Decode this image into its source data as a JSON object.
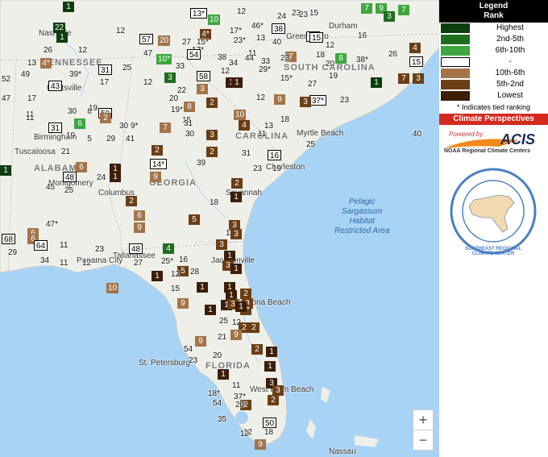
{
  "legend": {
    "title": "Legend",
    "subtitle": "Rank",
    "items": [
      {
        "label": "Highest",
        "color": "#0d3d0d"
      },
      {
        "label": "2nd-5th",
        "color": "#1f6d1f"
      },
      {
        "label": "6th-10th",
        "color": "#3fa63f"
      },
      {
        "label": "-",
        "color": "#ffffff"
      },
      {
        "label": "10th-6th",
        "color": "#a3744a"
      },
      {
        "label": "5th-2nd",
        "color": "#6b3e16"
      },
      {
        "label": "Lowest",
        "color": "#3c1e08"
      }
    ],
    "note": "* Indicates tied ranking"
  },
  "climate_perspectives": "Climate Perspectives",
  "acis": {
    "powered_by": "Powered by",
    "name": "ACIS",
    "sub": "NOAA Regional Climate Centers"
  },
  "logo": {
    "text": "SOUTHEAST REGIONAL CLIMATE CENTER"
  },
  "zoom": {
    "in": "+",
    "out": "−"
  },
  "colors": {
    "water": "#a9d3f5",
    "land": "#efefe9",
    "g1": "#0d3d0d",
    "g2": "#1f6d1f",
    "g3": "#3fa63f",
    "b1": "#a3744a",
    "b2": "#6b3e16",
    "b3": "#3c1e08"
  },
  "labels": {
    "states": [
      "TENNESSEE",
      "SOUTH CAROLINA",
      "CAROLINA",
      "ALABAMA",
      "GEORGIA",
      "FLORIDA"
    ],
    "cities": [
      "Nashville",
      "Huntsville",
      "Birmingham",
      "Tuscaloosa",
      "Montgomery",
      "Columbus",
      "Savannah",
      "Charleston",
      "Myrtle Beach",
      "Durham",
      "Greensboro",
      "Tallahassee",
      "Panama City",
      "Jacksonville",
      "Daytona Beach",
      "St. Petersburg",
      "West Palm Beach",
      "Nassau"
    ],
    "features": [
      "Pelagic\nSargassum\nHabitat\nRestricted Area"
    ]
  },
  "markers": [
    {
      "t": "1",
      "s": "g1"
    },
    {
      "t": "22",
      "s": "g1"
    },
    {
      "t": "1",
      "s": "g1"
    },
    {
      "t": "13*",
      "s": "box"
    },
    {
      "t": "10",
      "s": "g3"
    },
    {
      "t": "12",
      "s": "plain"
    },
    {
      "t": "7",
      "s": "g3"
    },
    {
      "t": "9",
      "s": "g3"
    },
    {
      "t": "3",
      "s": "g2"
    },
    {
      "t": "7",
      "s": "g3"
    },
    {
      "t": "24",
      "s": "plain"
    },
    {
      "t": "23",
      "s": "plain"
    },
    {
      "t": "15",
      "s": "plain"
    },
    {
      "t": "12",
      "s": "plain"
    },
    {
      "t": "57",
      "s": "box"
    },
    {
      "t": "20",
      "s": "b1"
    },
    {
      "t": "17*",
      "s": "plain"
    },
    {
      "t": "4*",
      "s": "b2"
    },
    {
      "t": "46*",
      "s": "plain"
    },
    {
      "t": "38",
      "s": "box"
    },
    {
      "t": "13",
      "s": "plain"
    },
    {
      "t": "15",
      "s": "box"
    },
    {
      "t": "23",
      "s": "plain"
    },
    {
      "t": "4",
      "s": "b2"
    },
    {
      "t": "26",
      "s": "plain"
    },
    {
      "t": "12",
      "s": "plain"
    },
    {
      "t": "27",
      "s": "plain"
    },
    {
      "t": "15*",
      "s": "plain"
    },
    {
      "t": "23*",
      "s": "plain"
    },
    {
      "t": "40",
      "s": "plain"
    },
    {
      "t": "12",
      "s": "plain"
    },
    {
      "t": "15",
      "s": "box"
    },
    {
      "t": "26",
      "s": "plain"
    },
    {
      "t": "16",
      "s": "plain"
    },
    {
      "t": "47",
      "s": "plain"
    },
    {
      "t": "17*",
      "s": "plain"
    },
    {
      "t": "54",
      "s": "box"
    },
    {
      "t": "11",
      "s": "plain"
    },
    {
      "t": "44",
      "s": "plain"
    },
    {
      "t": "7",
      "s": "b1"
    },
    {
      "t": "18",
      "s": "plain"
    },
    {
      "t": "8",
      "s": "g3"
    },
    {
      "t": "38*",
      "s": "plain"
    },
    {
      "t": "15",
      "s": "box"
    },
    {
      "t": "13",
      "s": "plain"
    },
    {
      "t": "4*",
      "s": "b1"
    },
    {
      "t": "10*",
      "s": "g3"
    },
    {
      "t": "33",
      "s": "plain"
    },
    {
      "t": "38",
      "s": "plain"
    },
    {
      "t": "34",
      "s": "plain"
    },
    {
      "t": "33",
      "s": "plain"
    },
    {
      "t": "23",
      "s": "plain"
    },
    {
      "t": "20",
      "s": "plain"
    },
    {
      "t": "29*",
      "s": "plain"
    },
    {
      "t": "52",
      "s": "plain"
    },
    {
      "t": "49",
      "s": "plain"
    },
    {
      "t": "39*",
      "s": "plain"
    },
    {
      "t": "31",
      "s": "box"
    },
    {
      "t": "25",
      "s": "plain"
    },
    {
      "t": "58",
      "s": "box"
    },
    {
      "t": "12",
      "s": "plain"
    },
    {
      "t": "1",
      "s": "b3"
    },
    {
      "t": "15*",
      "s": "plain"
    },
    {
      "t": "27",
      "s": "plain"
    },
    {
      "t": "19",
      "s": "plain"
    },
    {
      "t": "1",
      "s": "g1"
    },
    {
      "t": "7",
      "s": "b2"
    },
    {
      "t": "3",
      "s": "b2"
    },
    {
      "t": "43",
      "s": "box"
    },
    {
      "t": "17",
      "s": "plain"
    },
    {
      "t": "12",
      "s": "plain"
    },
    {
      "t": "3",
      "s": "g2"
    },
    {
      "t": "3",
      "s": "b1"
    },
    {
      "t": "37*",
      "s": "box"
    },
    {
      "t": "40",
      "s": "plain"
    },
    {
      "t": "23",
      "s": "plain"
    },
    {
      "t": "17",
      "s": "plain"
    },
    {
      "t": "20",
      "s": "plain"
    },
    {
      "t": "22",
      "s": "plain"
    },
    {
      "t": "47",
      "s": "plain"
    },
    {
      "t": "30",
      "s": "plain"
    },
    {
      "t": "8",
      "s": "plain"
    },
    {
      "t": "11",
      "s": "plain"
    },
    {
      "t": "50",
      "s": "box"
    },
    {
      "t": "19",
      "s": "plain"
    },
    {
      "t": "8",
      "s": "b1"
    },
    {
      "t": "19*",
      "s": "plain"
    },
    {
      "t": "2",
      "s": "b2"
    },
    {
      "t": "1",
      "s": "b3"
    },
    {
      "t": "10",
      "s": "b1"
    },
    {
      "t": "12",
      "s": "plain"
    },
    {
      "t": "9",
      "s": "b1"
    },
    {
      "t": "3",
      "s": "b2"
    },
    {
      "t": "11",
      "s": "plain"
    },
    {
      "t": "6",
      "s": "g3"
    },
    {
      "t": "2",
      "s": "b1"
    },
    {
      "t": "30",
      "s": "plain"
    },
    {
      "t": "9*",
      "s": "plain"
    },
    {
      "t": "15",
      "s": "plain"
    },
    {
      "t": "31",
      "s": "plain"
    },
    {
      "t": "7",
      "s": "b1"
    },
    {
      "t": "4",
      "s": "b2"
    },
    {
      "t": "13",
      "s": "plain"
    },
    {
      "t": "18",
      "s": "plain"
    },
    {
      "t": "31",
      "s": "box"
    },
    {
      "t": "19",
      "s": "plain"
    },
    {
      "t": "5",
      "s": "plain"
    },
    {
      "t": "29",
      "s": "plain"
    },
    {
      "t": "41",
      "s": "plain"
    },
    {
      "t": "30",
      "s": "plain"
    },
    {
      "t": "3",
      "s": "b2"
    },
    {
      "t": "11",
      "s": "plain"
    },
    {
      "t": "25",
      "s": "plain"
    },
    {
      "t": "21",
      "s": "plain"
    },
    {
      "t": "2",
      "s": "b2"
    },
    {
      "t": "2",
      "s": "b2"
    },
    {
      "t": "31",
      "s": "plain"
    },
    {
      "t": "16",
      "s": "box"
    },
    {
      "t": "1",
      "s": "g1"
    },
    {
      "t": "6",
      "s": "b1"
    },
    {
      "t": "14*",
      "s": "box"
    },
    {
      "t": "39",
      "s": "plain"
    },
    {
      "t": "23",
      "s": "plain"
    },
    {
      "t": "19",
      "s": "plain"
    },
    {
      "t": "48",
      "s": "box"
    },
    {
      "t": "24",
      "s": "plain"
    },
    {
      "t": "1",
      "s": "b3"
    },
    {
      "t": "1",
      "s": "b3"
    },
    {
      "t": "9",
      "s": "b1"
    },
    {
      "t": "2",
      "s": "b2"
    },
    {
      "t": "45",
      "s": "plain"
    },
    {
      "t": "25",
      "s": "plain"
    },
    {
      "t": "1",
      "s": "b3"
    },
    {
      "t": "2",
      "s": "b2"
    },
    {
      "t": "18",
      "s": "plain"
    },
    {
      "t": "6",
      "s": "b1"
    },
    {
      "t": "5",
      "s": "b2"
    },
    {
      "t": "47*",
      "s": "plain"
    },
    {
      "t": "9",
      "s": "b1"
    },
    {
      "t": "3",
      "s": "b2"
    },
    {
      "t": "6",
      "s": "b1"
    },
    {
      "t": "11",
      "s": "plain"
    },
    {
      "t": "3",
      "s": "b2"
    },
    {
      "t": "68",
      "s": "box"
    },
    {
      "t": "6",
      "s": "b1"
    },
    {
      "t": "64",
      "s": "box"
    },
    {
      "t": "11",
      "s": "plain"
    },
    {
      "t": "23",
      "s": "plain"
    },
    {
      "t": "48",
      "s": "box"
    },
    {
      "t": "4",
      "s": "g2"
    },
    {
      "t": "3",
      "s": "b2"
    },
    {
      "t": "29",
      "s": "plain"
    },
    {
      "t": "34",
      "s": "plain"
    },
    {
      "t": "25*",
      "s": "plain"
    },
    {
      "t": "16",
      "s": "plain"
    },
    {
      "t": "1",
      "s": "b3"
    },
    {
      "t": "3",
      "s": "b2"
    },
    {
      "t": "11",
      "s": "plain"
    },
    {
      "t": "12",
      "s": "plain"
    },
    {
      "t": "27",
      "s": "plain"
    },
    {
      "t": "1",
      "s": "b3"
    },
    {
      "t": "10",
      "s": "b1"
    },
    {
      "t": "1",
      "s": "b3"
    },
    {
      "t": "5",
      "s": "b2"
    },
    {
      "t": "12",
      "s": "plain"
    },
    {
      "t": "28",
      "s": "plain"
    },
    {
      "t": "1",
      "s": "b3"
    },
    {
      "t": "1",
      "s": "b3"
    },
    {
      "t": "15",
      "s": "plain"
    },
    {
      "t": "1",
      "s": "b3"
    },
    {
      "t": "2",
      "s": "b2"
    },
    {
      "t": "1",
      "s": "b3"
    },
    {
      "t": "9",
      "s": "b1"
    },
    {
      "t": "1",
      "s": "b3"
    },
    {
      "t": "3",
      "s": "b2"
    },
    {
      "t": "3",
      "s": "b2"
    },
    {
      "t": "4*",
      "s": "b2"
    },
    {
      "t": "1",
      "s": "b3"
    },
    {
      "t": "25",
      "s": "plain"
    },
    {
      "t": "12",
      "s": "plain"
    },
    {
      "t": "2",
      "s": "b2"
    },
    {
      "t": "2",
      "s": "b2"
    },
    {
      "t": "54",
      "s": "plain"
    },
    {
      "t": "9",
      "s": "b1"
    },
    {
      "t": "21",
      "s": "plain"
    },
    {
      "t": "9",
      "s": "b1"
    },
    {
      "t": "2",
      "s": "b2"
    },
    {
      "t": "1",
      "s": "b3"
    },
    {
      "t": "23",
      "s": "plain"
    },
    {
      "t": "20",
      "s": "plain"
    },
    {
      "t": "1",
      "s": "b3"
    },
    {
      "t": "1",
      "s": "b3"
    },
    {
      "t": "11",
      "s": "plain"
    },
    {
      "t": "3",
      "s": "b3"
    },
    {
      "t": "3",
      "s": "b2"
    },
    {
      "t": "18*",
      "s": "plain"
    },
    {
      "t": "37*",
      "s": "plain"
    },
    {
      "t": "2",
      "s": "b2"
    },
    {
      "t": "2",
      "s": "b2"
    },
    {
      "t": "54",
      "s": "plain"
    },
    {
      "t": "20*",
      "s": "plain"
    },
    {
      "t": "12",
      "s": "plain"
    },
    {
      "t": "35",
      "s": "plain"
    },
    {
      "t": "50",
      "s": "box"
    },
    {
      "t": "12",
      "s": "plain"
    },
    {
      "t": "18",
      "s": "plain"
    },
    {
      "t": "9",
      "s": "b1"
    }
  ]
}
